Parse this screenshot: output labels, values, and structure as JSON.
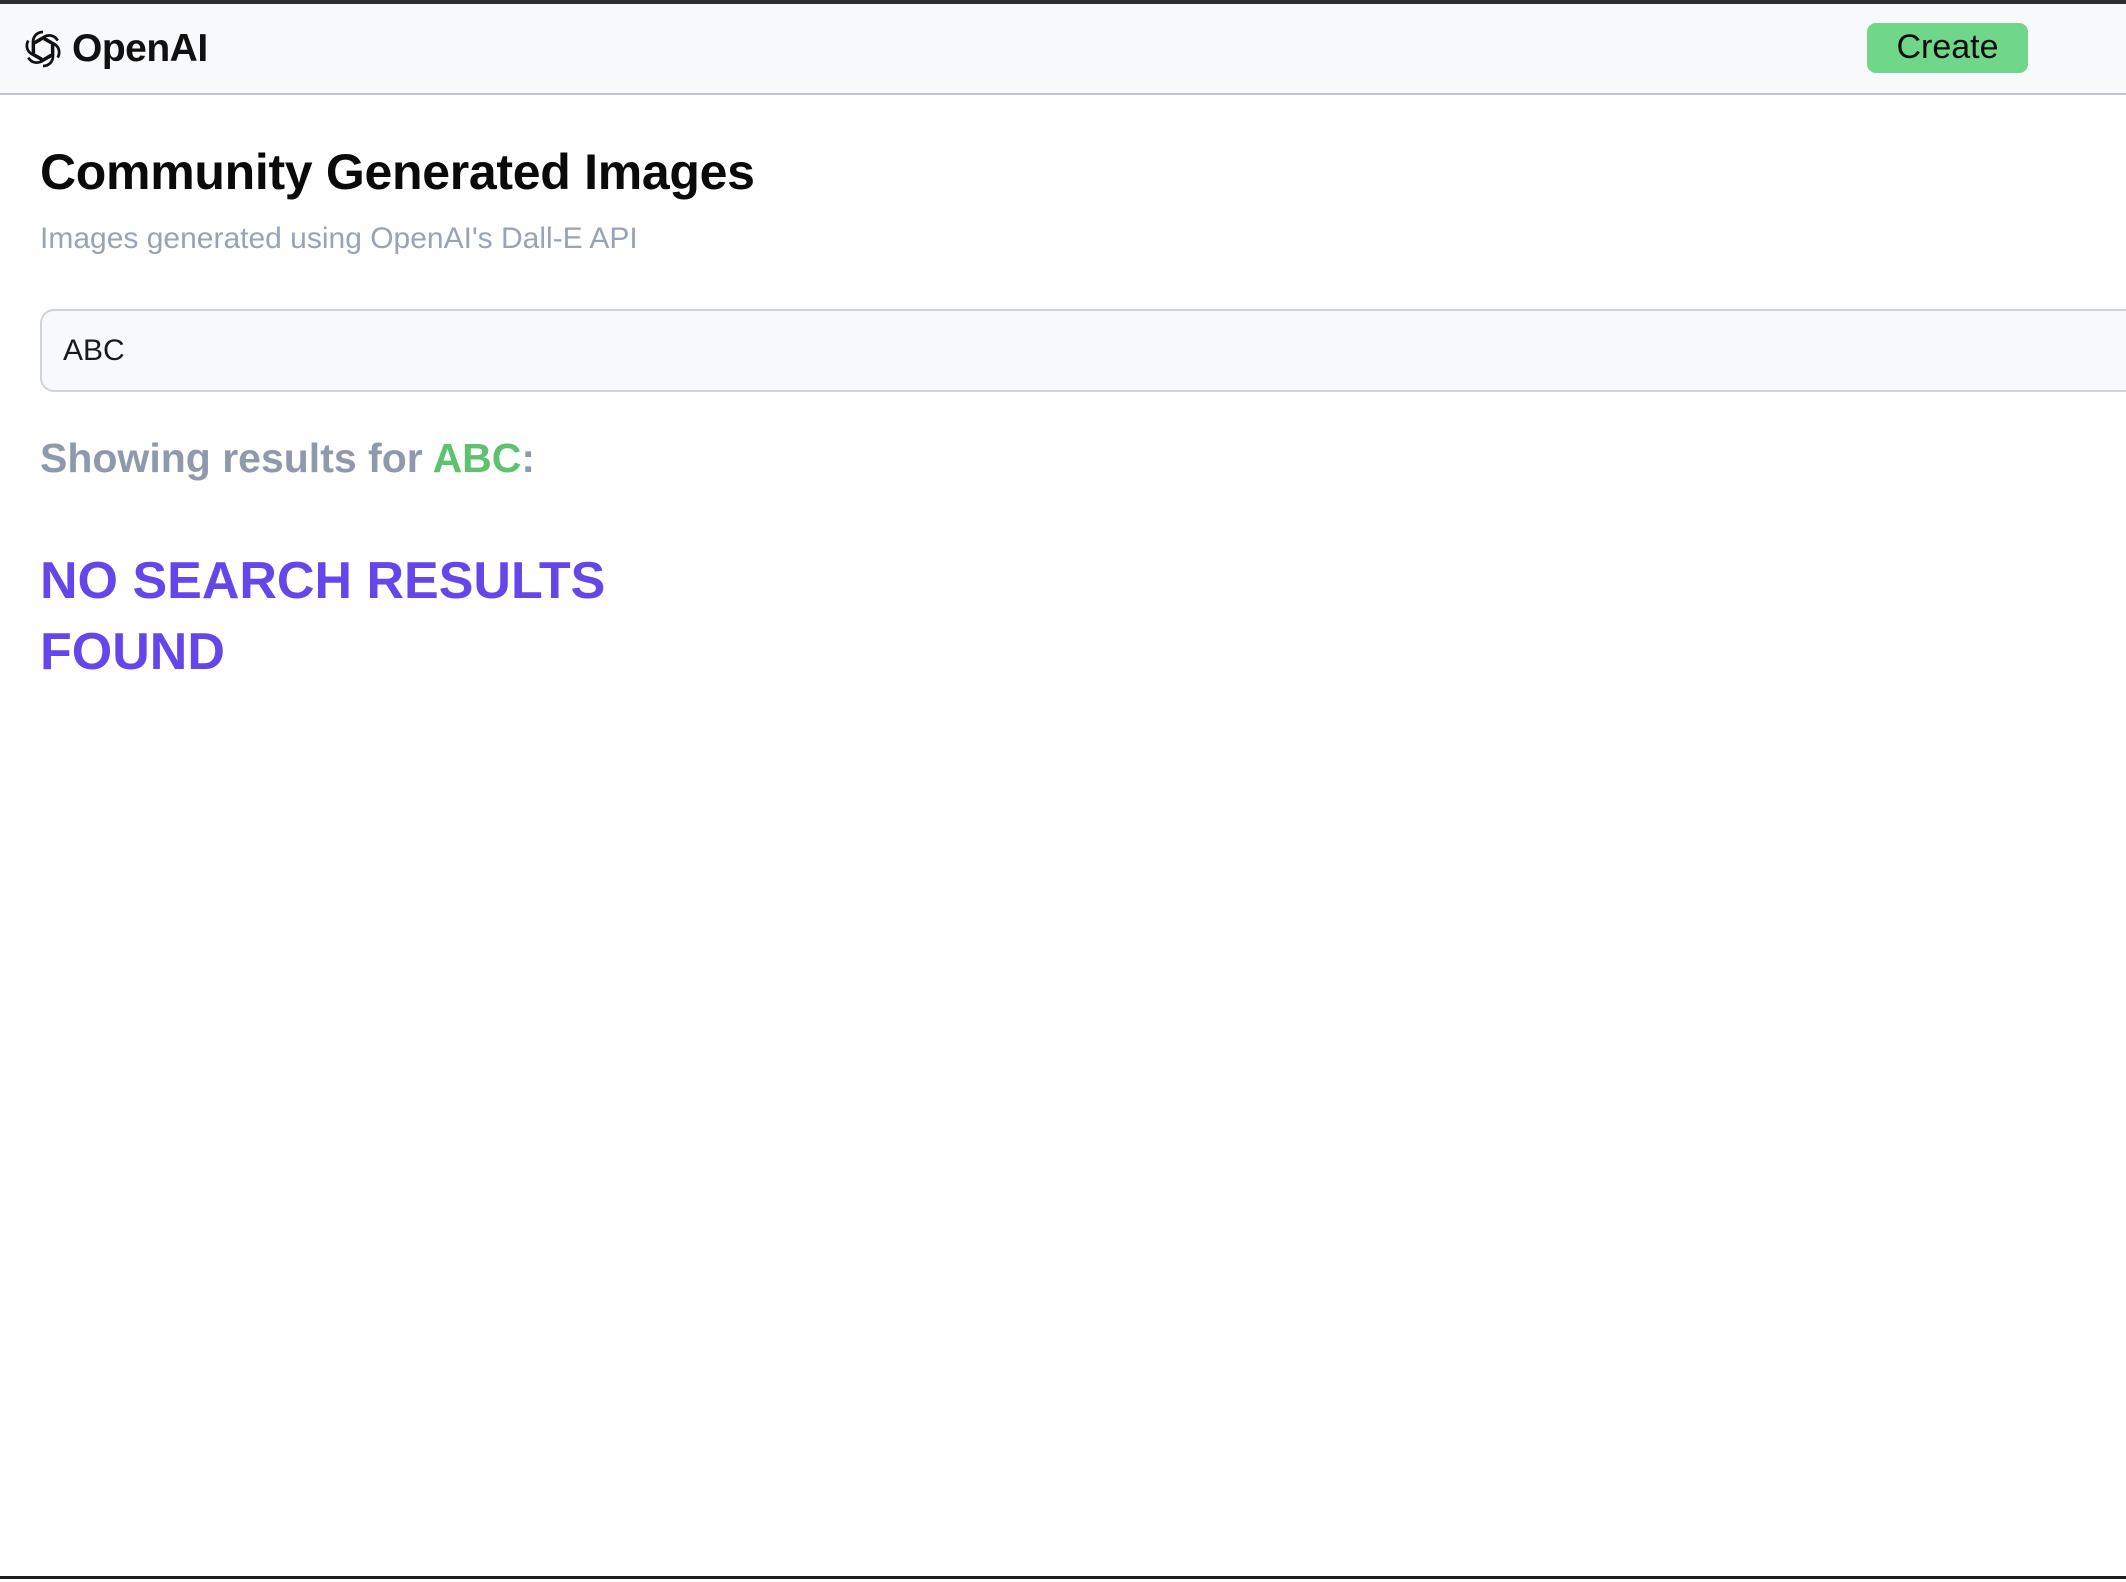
{
  "header": {
    "logo_text": "OpenAI",
    "create_label": "Create"
  },
  "main": {
    "title": "Community Generated Images",
    "subtitle": "Images generated using OpenAI's Dall-E API",
    "search": {
      "value": "ABC"
    },
    "results": {
      "prefix": "Showing results for ",
      "query": "ABC",
      "suffix": ":",
      "empty_message": "NO SEARCH RESULTS FOUND"
    }
  },
  "icons": {
    "logo": "openai-logo-icon"
  },
  "colors": {
    "accent_green": "#6fd68a",
    "query_green": "#5cc26d",
    "empty_purple": "#6546ea",
    "muted_text": "#98a3b5"
  }
}
